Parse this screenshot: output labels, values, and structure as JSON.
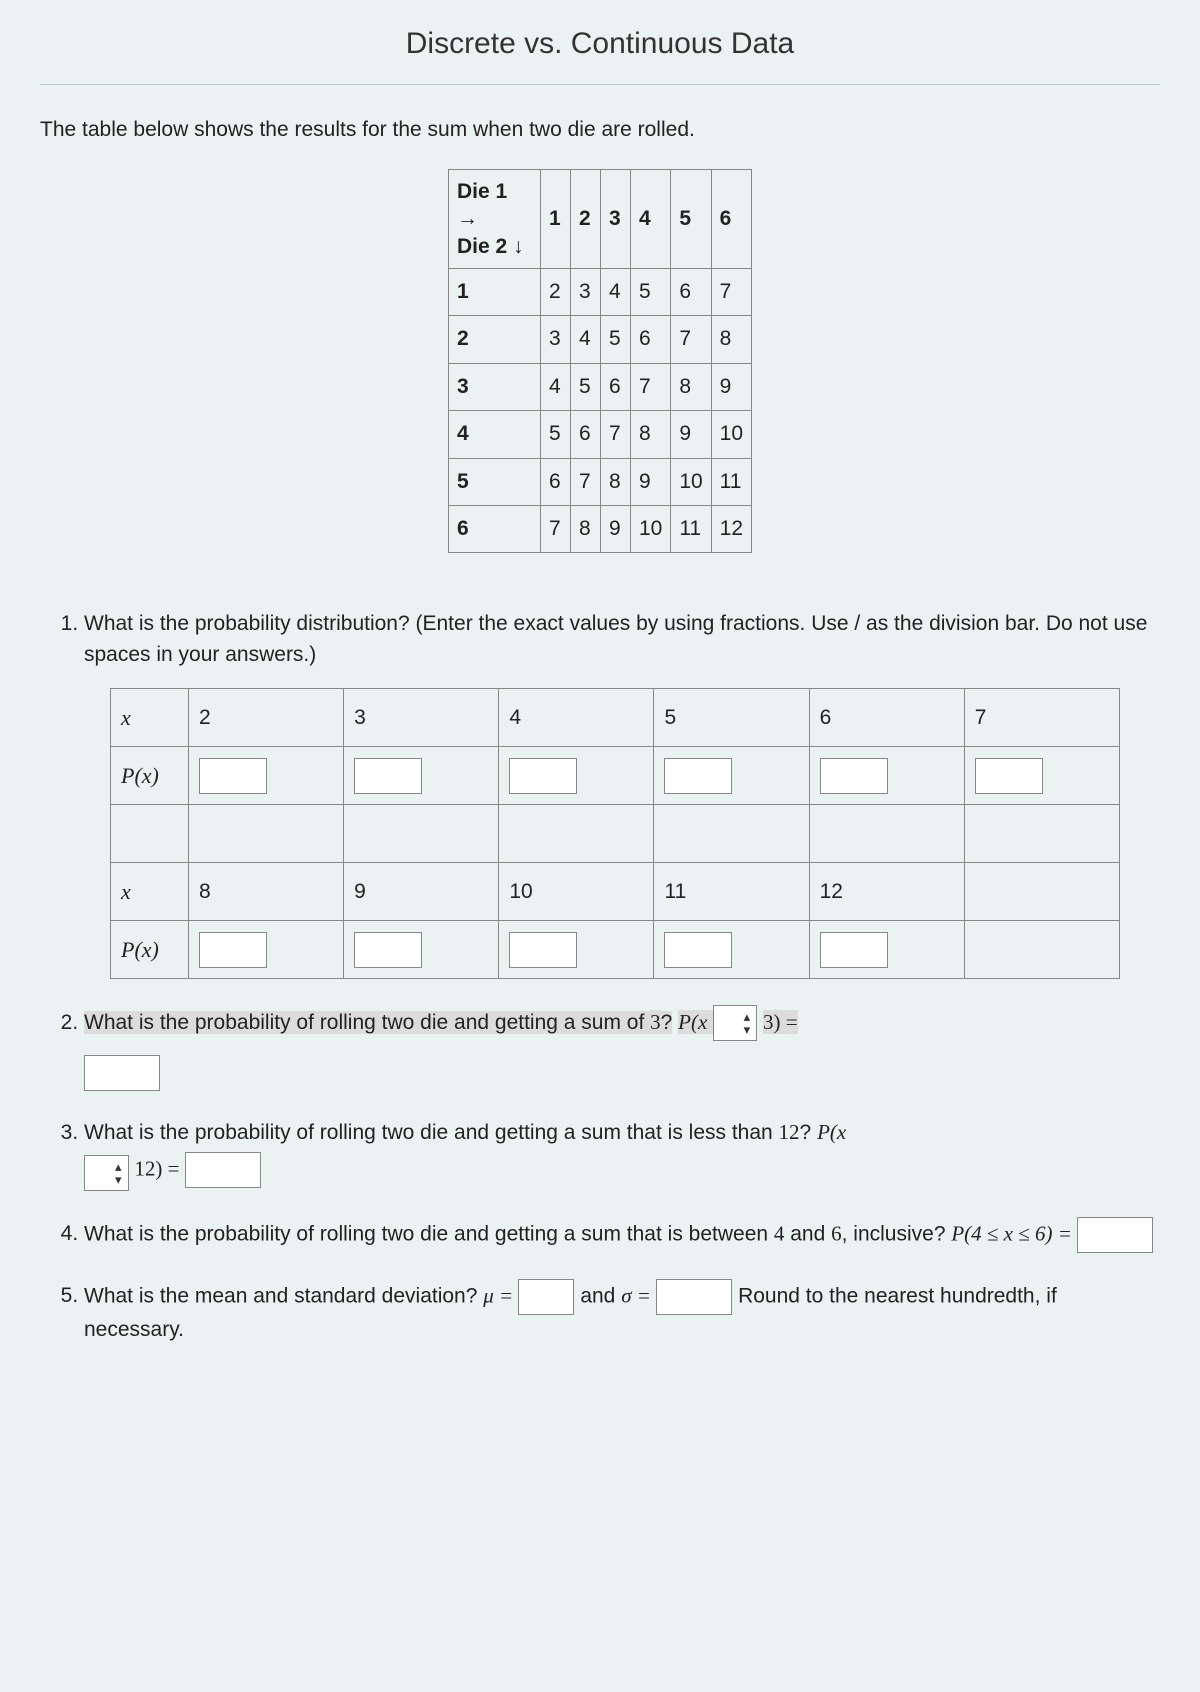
{
  "title": "Discrete vs. Continuous Data",
  "intro": "The table below shows the results for the sum when two die are rolled.",
  "dice": {
    "corner_top": "Die 1 →",
    "corner_bottom": "Die 2 ↓",
    "col_headers": [
      "1",
      "2",
      "3",
      "4",
      "5",
      "6"
    ],
    "rows": [
      {
        "h": "1",
        "cells": [
          "2",
          "3",
          "4",
          "5",
          "6",
          "7"
        ]
      },
      {
        "h": "2",
        "cells": [
          "3",
          "4",
          "5",
          "6",
          "7",
          "8"
        ]
      },
      {
        "h": "3",
        "cells": [
          "4",
          "5",
          "6",
          "7",
          "8",
          "9"
        ]
      },
      {
        "h": "4",
        "cells": [
          "5",
          "6",
          "7",
          "8",
          "9",
          "10"
        ]
      },
      {
        "h": "5",
        "cells": [
          "6",
          "7",
          "8",
          "9",
          "10",
          "11"
        ]
      },
      {
        "h": "6",
        "cells": [
          "7",
          "8",
          "9",
          "10",
          "11",
          "12"
        ]
      }
    ]
  },
  "q1": {
    "text": "What is the probability distribution? (Enter the exact values by using fractions. Use / as the division bar. Do not use spaces in your answers.)",
    "x_label": "x",
    "px_label": "P(x)",
    "row1_x": [
      "2",
      "3",
      "4",
      "5",
      "6",
      "7"
    ],
    "row2_x": [
      "8",
      "9",
      "10",
      "11",
      "12",
      ""
    ]
  },
  "q2": {
    "text_a": "What is the probability of rolling two die and getting a sum of ",
    "three": "3",
    "qmark": "?",
    "px_open": " P(x ",
    "close": " 3) ="
  },
  "q3": {
    "text_a": "What is the probability of rolling two die and getting a sum that is less than ",
    "twelve": "12",
    "qmark": "?",
    "px": " P(x",
    "twelve_close": " 12) = "
  },
  "q4": {
    "text_a": "What is the probability of rolling two die and getting a sum that is between ",
    "four": "4",
    "and": " and ",
    "six": "6",
    "inclusive": ", inclusive? ",
    "expr": "P(4 ≤ x ≤ 6) = "
  },
  "q5": {
    "text_a": "What is the mean and standard deviation? ",
    "mu": "μ = ",
    "and": " and ",
    "sigma": "σ = ",
    "round": " Round to the nearest hundredth, if necessary."
  }
}
